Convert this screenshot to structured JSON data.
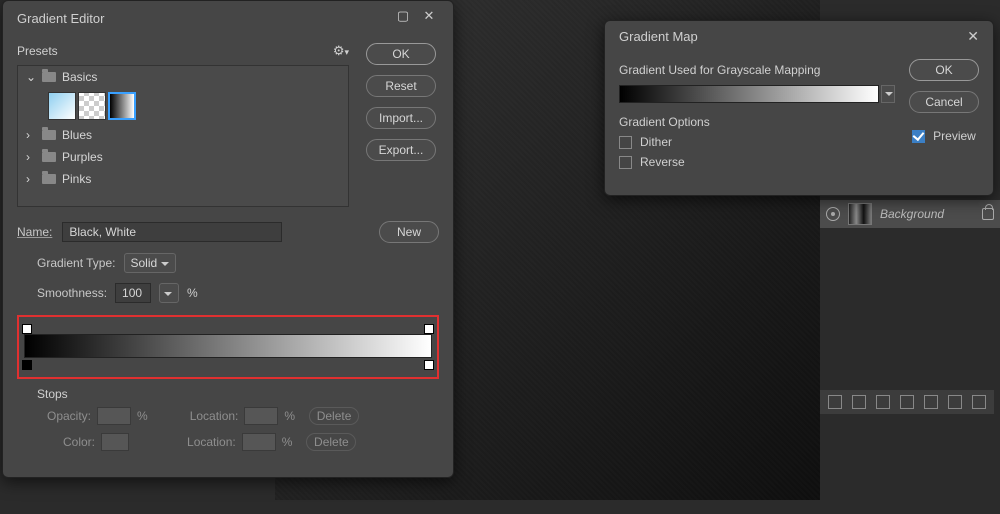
{
  "canvas": {
    "layer_name": "Background"
  },
  "gradient_editor": {
    "title": "Gradient Editor",
    "presets_label": "Presets",
    "folders": {
      "basics": "Basics",
      "blues": "Blues",
      "purples": "Purples",
      "pinks": "Pinks"
    },
    "buttons": {
      "ok": "OK",
      "reset": "Reset",
      "import": "Import...",
      "export": "Export...",
      "new": "New"
    },
    "name_label": "Name:",
    "name_value": "Black, White",
    "type_label": "Gradient Type:",
    "type_value": "Solid",
    "smoothness_label": "Smoothness:",
    "smoothness_value": "100",
    "smoothness_unit": "%",
    "stops_title": "Stops",
    "opacity_label": "Opacity:",
    "location_label": "Location:",
    "percent": "%",
    "color_label": "Color:",
    "delete": "Delete"
  },
  "gradient_map": {
    "title": "Gradient Map",
    "heading": "Gradient Used for Grayscale Mapping",
    "options_title": "Gradient Options",
    "dither": "Dither",
    "reverse": "Reverse",
    "preview": "Preview",
    "ok": "OK",
    "cancel": "Cancel"
  }
}
